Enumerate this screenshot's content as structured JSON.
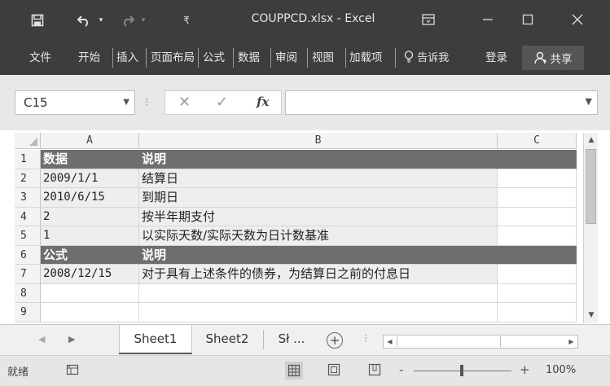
{
  "window": {
    "title": "COUPPCD.xlsx - Excel",
    "icons": {
      "save": "save-icon",
      "undo": "undo-icon",
      "redo": "redo-icon",
      "customize": "customize-qat-icon",
      "ribbon_display": "ribbon-display-icon",
      "minimize": "minimize-icon",
      "maximize": "maximize-icon",
      "close": "close-icon"
    }
  },
  "ribbon": {
    "tabs": [
      "文件",
      "开始",
      "插入",
      "页面布局",
      "公式",
      "数据",
      "审阅",
      "视图",
      "加载项"
    ],
    "tell_me": "告诉我",
    "login": "登录",
    "share": "共享"
  },
  "formula_bar": {
    "name_box": "C15",
    "fx_label": "fx",
    "value": ""
  },
  "grid": {
    "columns": [
      "A",
      "B",
      "C"
    ],
    "row_numbers": [
      "1",
      "2",
      "3",
      "4",
      "5",
      "6",
      "7",
      "8",
      "9"
    ],
    "rows": [
      {
        "a": "数据",
        "b": "说明",
        "style": "header"
      },
      {
        "a": "2009/1/1",
        "b": "结算日",
        "style": "band"
      },
      {
        "a": "2010/6/15",
        "b": "到期日",
        "style": "band"
      },
      {
        "a": "2",
        "b": "按半年期支付",
        "style": "band"
      },
      {
        "a": "1",
        "b": "以实际天数/实际天数为日计数基准",
        "style": "band"
      },
      {
        "a": "公式",
        "b": "说明",
        "style": "header"
      },
      {
        "a": "2008/12/15",
        "b": "对于具有上述条件的债券，为结算日之前的付息日",
        "style": "band"
      },
      {
        "a": "",
        "b": "",
        "style": "plain"
      },
      {
        "a": "",
        "b": "",
        "style": "plain"
      }
    ]
  },
  "sheets": {
    "tabs": [
      "Sheet1",
      "Sheet2",
      "Sł ..."
    ],
    "active": "Sheet1"
  },
  "status": {
    "ready": "就绪",
    "zoom": "100%",
    "zoom_minus": "-",
    "zoom_plus": "+"
  },
  "colors": {
    "titlebar": "#3d3d3d",
    "header_row": "#6e6e6e",
    "band_row": "#eeeeee"
  }
}
